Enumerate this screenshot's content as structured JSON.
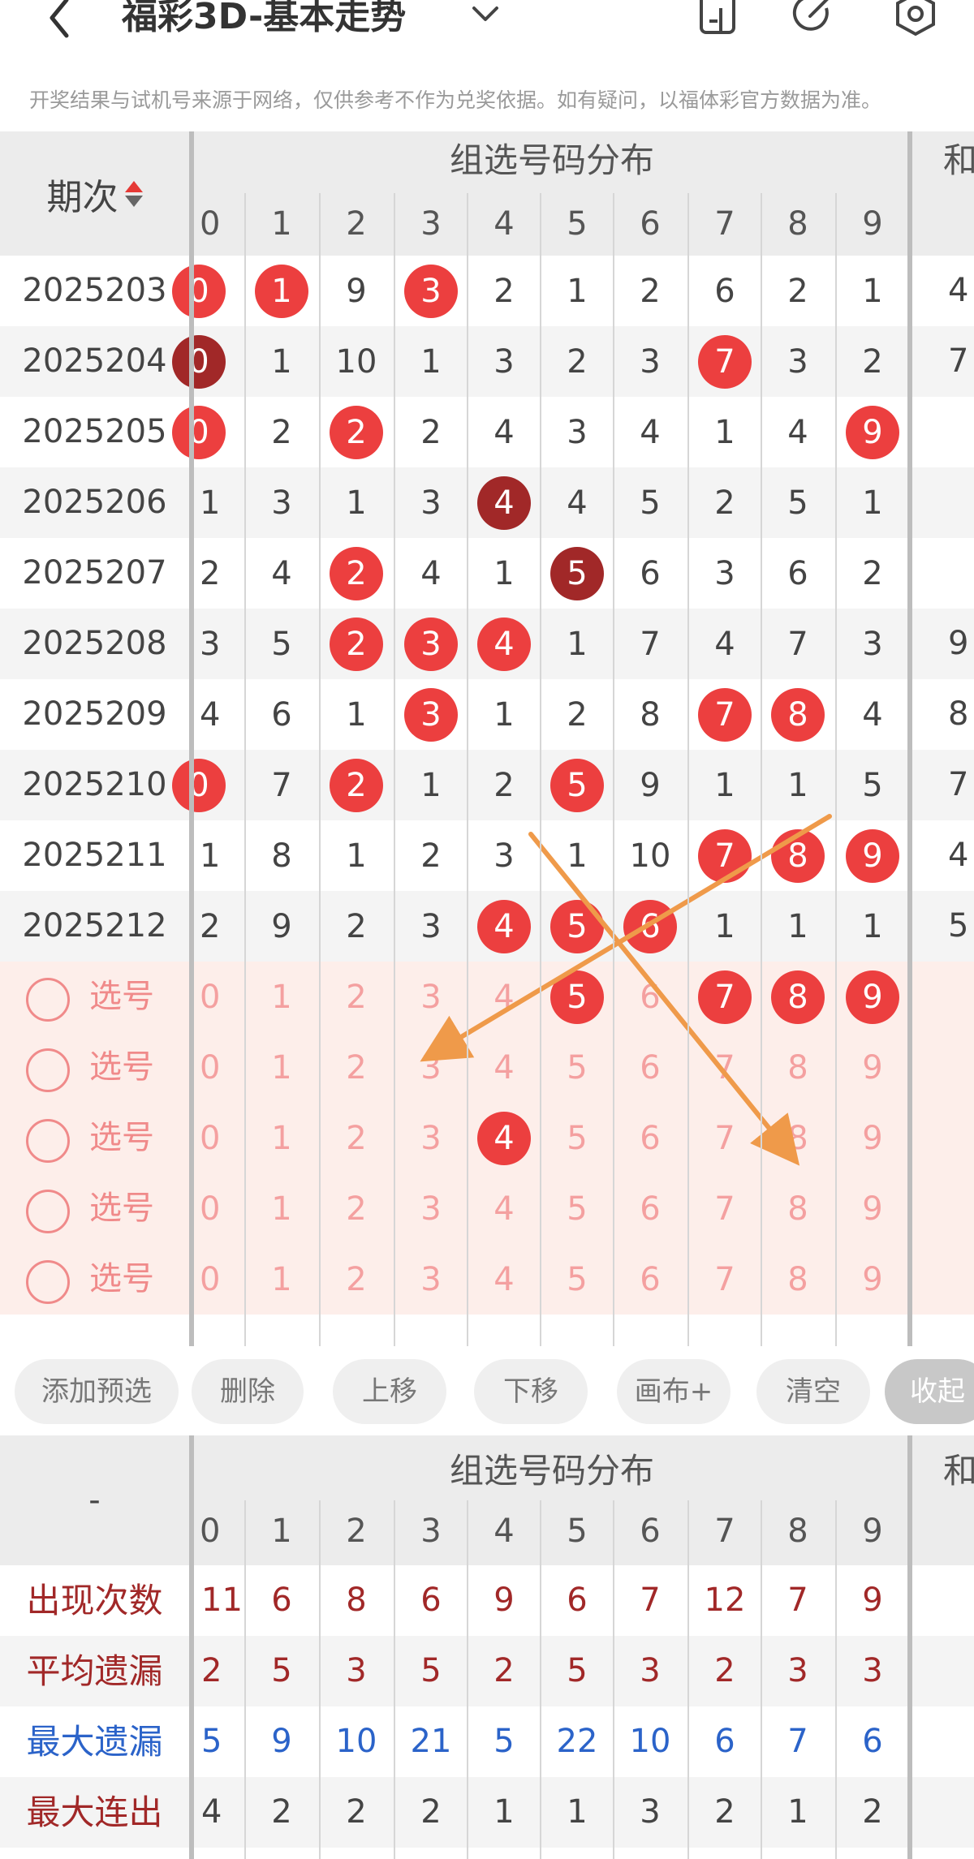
{
  "header": {
    "title": "福彩3D-基本走势",
    "notice": "开奖结果与试机号来源于网络，仅供参考不作为兑奖依据。如有疑问，以福体彩官方数据为准。",
    "icons": [
      "back-icon",
      "chevron-down-icon",
      "phone-icon",
      "share-icon",
      "settings-icon"
    ]
  },
  "table": {
    "period_label": "期次",
    "group_title": "组选号码分布",
    "sum_title": "和",
    "digits": [
      "0",
      "1",
      "2",
      "3",
      "4",
      "5",
      "6",
      "7",
      "8",
      "9"
    ],
    "rows": [
      {
        "period": "2025203",
        "cells": [
          "0",
          "1",
          "9",
          "3",
          "2",
          "1",
          "2",
          "6",
          "2",
          "1"
        ],
        "sum": "4"
      },
      {
        "period": "2025204",
        "cells": [
          "0",
          "1",
          "10",
          "1",
          "3",
          "2",
          "3",
          "7",
          "3",
          "2"
        ],
        "sum": "7"
      },
      {
        "period": "2025205",
        "cells": [
          "0",
          "2",
          "2",
          "2",
          "4",
          "3",
          "4",
          "1",
          "4",
          "9"
        ],
        "sum": ""
      },
      {
        "period": "2025206",
        "cells": [
          "1",
          "3",
          "1",
          "3",
          "4",
          "4",
          "5",
          "2",
          "5",
          "1"
        ],
        "sum": ""
      },
      {
        "period": "2025207",
        "cells": [
          "2",
          "4",
          "2",
          "4",
          "1",
          "5",
          "6",
          "3",
          "6",
          "2"
        ],
        "sum": ""
      },
      {
        "period": "2025208",
        "cells": [
          "3",
          "5",
          "2",
          "3",
          "4",
          "1",
          "7",
          "4",
          "7",
          "3"
        ],
        "sum": "9"
      },
      {
        "period": "2025209",
        "cells": [
          "4",
          "6",
          "1",
          "3",
          "1",
          "2",
          "8",
          "7",
          "8",
          "4"
        ],
        "sum": "8"
      },
      {
        "period": "2025210",
        "cells": [
          "0",
          "7",
          "2",
          "1",
          "2",
          "5",
          "9",
          "1",
          "1",
          "5"
        ],
        "sum": "7"
      },
      {
        "period": "2025211",
        "cells": [
          "1",
          "8",
          "1",
          "2",
          "3",
          "1",
          "10",
          "7",
          "8",
          "9"
        ],
        "sum": "4"
      },
      {
        "period": "2025212",
        "cells": [
          "2",
          "9",
          "2",
          "3",
          "4",
          "5",
          "6",
          "1",
          "1",
          "1"
        ],
        "sum": "5"
      }
    ],
    "pick_label": "选号"
  },
  "toolbar": {
    "add": "添加预选",
    "delete": "删除",
    "up": "上移",
    "down": "下移",
    "canvas": "画布+",
    "clear": "清空",
    "collapse": "收起"
  },
  "stats": {
    "dash": "-",
    "group_title": "组选号码分布",
    "sum_title": "和",
    "rows": [
      {
        "label": "出现次数",
        "values": [
          "11",
          "6",
          "8",
          "6",
          "9",
          "6",
          "7",
          "12",
          "7",
          "9"
        ]
      },
      {
        "label": "平均遗漏",
        "values": [
          "2",
          "5",
          "3",
          "5",
          "2",
          "5",
          "3",
          "2",
          "3",
          "3"
        ]
      },
      {
        "label": "最大遗漏",
        "values": [
          "5",
          "9",
          "10",
          "21",
          "5",
          "22",
          "10",
          "6",
          "7",
          "6"
        ]
      },
      {
        "label": "最大连出",
        "values": [
          "4",
          "2",
          "2",
          "2",
          "1",
          "1",
          "3",
          "2",
          "1",
          "2"
        ]
      }
    ]
  },
  "colors": {
    "ball_red": "#ec3f3f",
    "ball_dark": "#a12828",
    "arrow": "#ef9a4a",
    "stat_red": "#a12828",
    "stat_blue": "#2b63c9"
  }
}
